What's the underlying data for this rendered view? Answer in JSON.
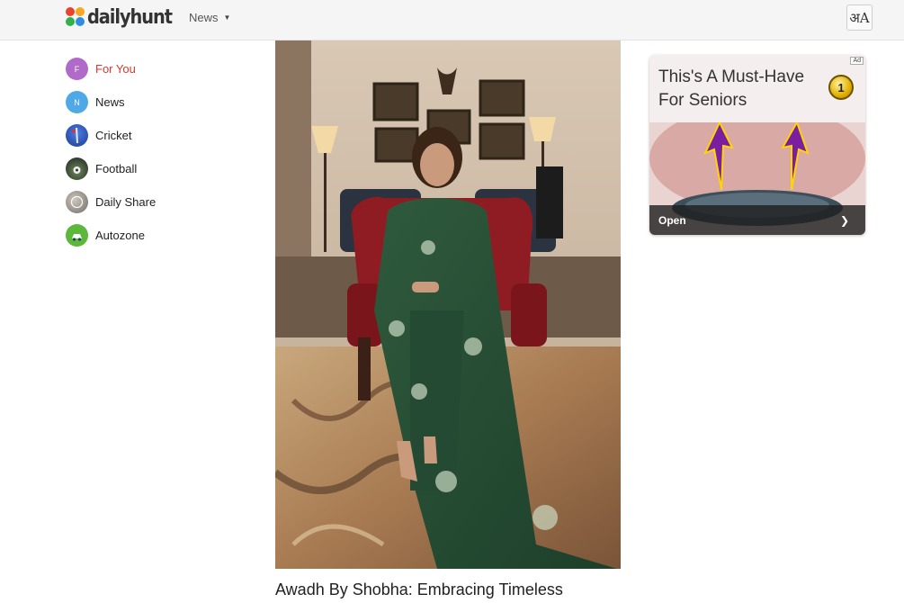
{
  "header": {
    "logo_text": "dailyhunt",
    "nav_label": "News",
    "language_icon_text": "अA"
  },
  "sidebar": {
    "items": [
      {
        "label": "For You",
        "initial": "F",
        "color": "#b06ac8",
        "active": true
      },
      {
        "label": "News",
        "initial": "N",
        "color": "#4fa9e6"
      },
      {
        "label": "Cricket",
        "initial": "",
        "color": "#2a5cc8"
      },
      {
        "label": "Football",
        "initial": "",
        "color": "#3a3a3a"
      },
      {
        "label": "Daily Share",
        "initial": "",
        "color": "#8a8a8a"
      },
      {
        "label": "Autozone",
        "initial": "",
        "color": "#5cb83a"
      }
    ]
  },
  "article": {
    "headline": "Awadh By Shobha: Embracing Timeless"
  },
  "ad": {
    "text": "This's A Must-Have For Seniors",
    "badge": "Ad",
    "medal": "1",
    "cta": "Open"
  },
  "colors": {
    "active": "#d23a30",
    "header_bg": "#f5f5f5"
  }
}
